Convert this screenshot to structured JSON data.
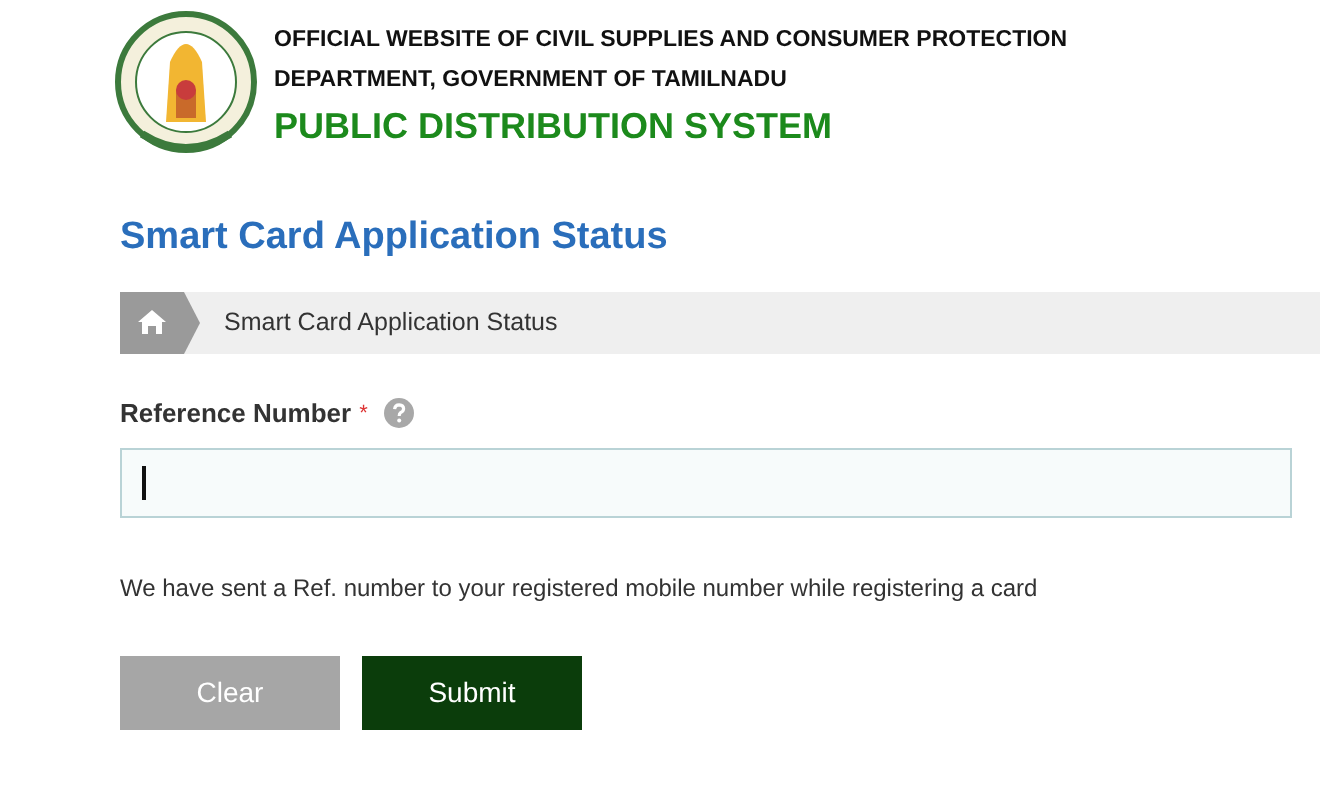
{
  "header": {
    "line_1": "OFFICIAL WEBSITE OF CIVIL SUPPLIES AND CONSUMER PROTECTION",
    "line_2": "DEPARTMENT, GOVERNMENT OF TAMILNADU",
    "title": "PUBLIC DISTRIBUTION SYSTEM"
  },
  "page_title": "Smart Card Application Status",
  "breadcrumb": {
    "current": "Smart Card Application Status"
  },
  "field": {
    "label": "Reference Number",
    "required_mark": "*",
    "focused": true
  },
  "note": "We have sent a Ref. number to your registered mobile number while registering a card",
  "buttons": [
    {
      "label": "Clear",
      "kind": "secondary"
    },
    {
      "label": "Submit",
      "kind": "primary"
    }
  ]
}
